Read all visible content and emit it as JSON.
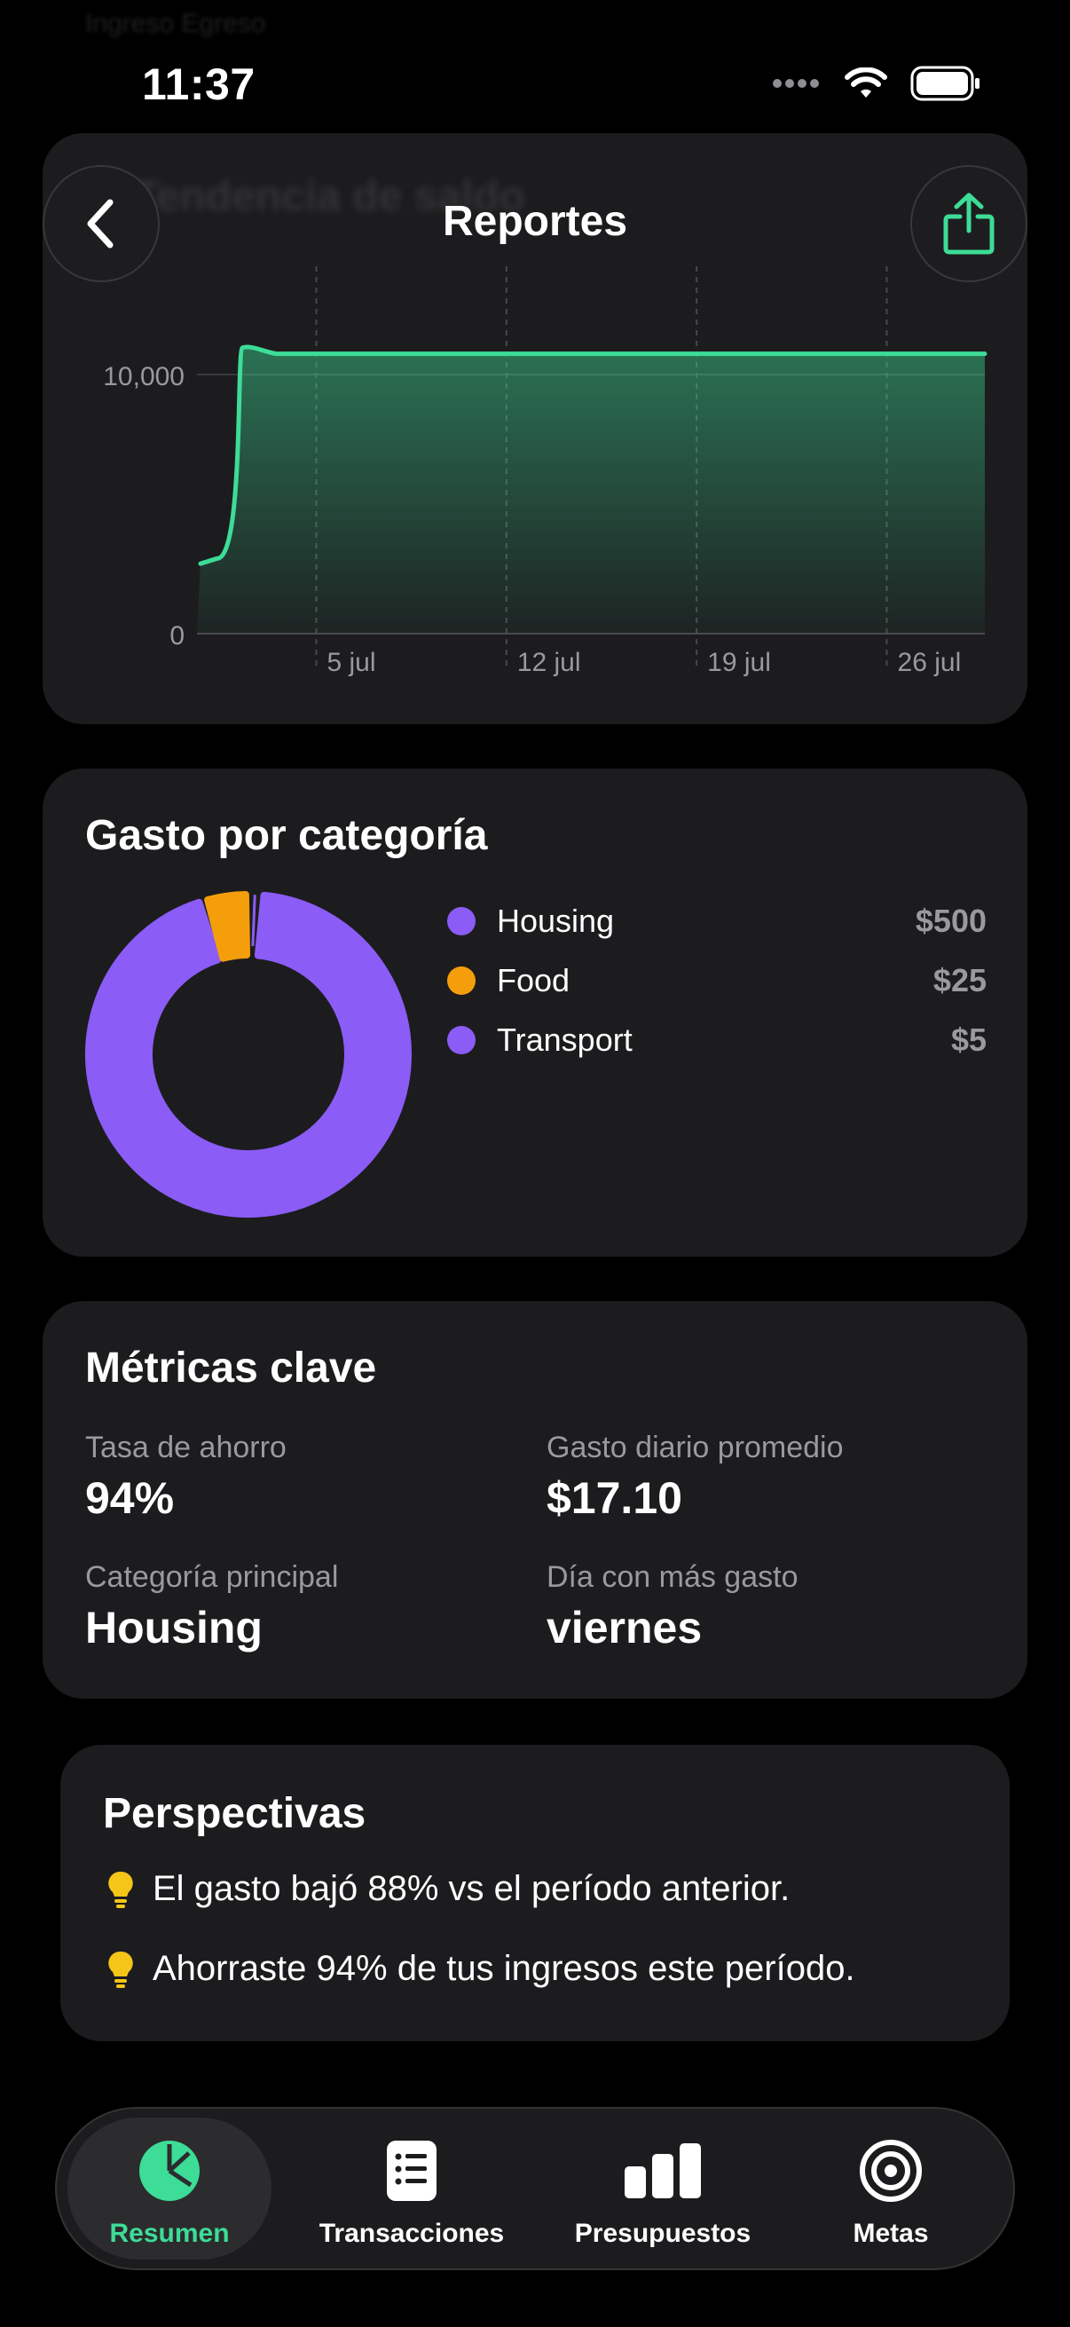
{
  "status_bar": {
    "time": "11:37"
  },
  "ghost": {
    "legend_text": "Ingreso   Egreso",
    "title_text": "Tendencia de saldo"
  },
  "header": {
    "title": "Reportes"
  },
  "balance_chart": {
    "chart_data": {
      "type": "area",
      "title": "",
      "xlabel": "",
      "ylabel": "",
      "x_ticks": [
        "5 jul",
        "12 jul",
        "19 jul",
        "26 jul"
      ],
      "y_ticks": [
        "0",
        "10,000"
      ],
      "ylim": [
        0,
        10000
      ],
      "x": [
        "1 jul",
        "2 jul",
        "3 jul",
        "5 jul",
        "12 jul",
        "19 jul",
        "26 jul",
        "30 jul"
      ],
      "values": [
        2700,
        2900,
        10900,
        10800,
        10800,
        10800,
        10800,
        10800
      ],
      "grid": true,
      "color": "#3ddc97"
    }
  },
  "category": {
    "title": "Gasto por categoría",
    "chart_data": {
      "type": "pie",
      "donut": true,
      "labels": [
        "Housing",
        "Food",
        "Transport"
      ],
      "values": [
        500,
        25,
        5
      ],
      "colors": [
        "#8b5cf6",
        "#f59e0b",
        "#8b5cf6"
      ]
    },
    "legend": [
      {
        "label": "Housing",
        "amount": "$500",
        "color": "#8b5cf6"
      },
      {
        "label": "Food",
        "amount": "$25",
        "color": "#f59e0b"
      },
      {
        "label": "Transport",
        "amount": "$5",
        "color": "#8b5cf6"
      }
    ]
  },
  "metrics": {
    "title": "Métricas clave",
    "items": [
      {
        "label": "Tasa de ahorro",
        "value": "94%"
      },
      {
        "label": "Gasto diario promedio",
        "value": "$17.10"
      },
      {
        "label": "Categoría principal",
        "value": "Housing"
      },
      {
        "label": "Día con más gasto",
        "value": "viernes"
      }
    ]
  },
  "insights": {
    "title": "Perspectivas",
    "items": [
      {
        "text": "El gasto bajó 88% vs el período anterior."
      },
      {
        "text": "Ahorraste 94% de tus ingresos este período."
      }
    ]
  },
  "tabs": [
    {
      "label": "Resumen",
      "icon": "pie-chart-icon",
      "active": true
    },
    {
      "label": "Transacciones",
      "icon": "list-icon",
      "active": false
    },
    {
      "label": "Presupuestos",
      "icon": "bar-chart-icon",
      "active": false
    },
    {
      "label": "Metas",
      "icon": "target-icon",
      "active": false
    }
  ],
  "colors": {
    "accent": "#3ddc97",
    "housing": "#8b5cf6",
    "food": "#f59e0b",
    "insight": "#f5c518"
  }
}
